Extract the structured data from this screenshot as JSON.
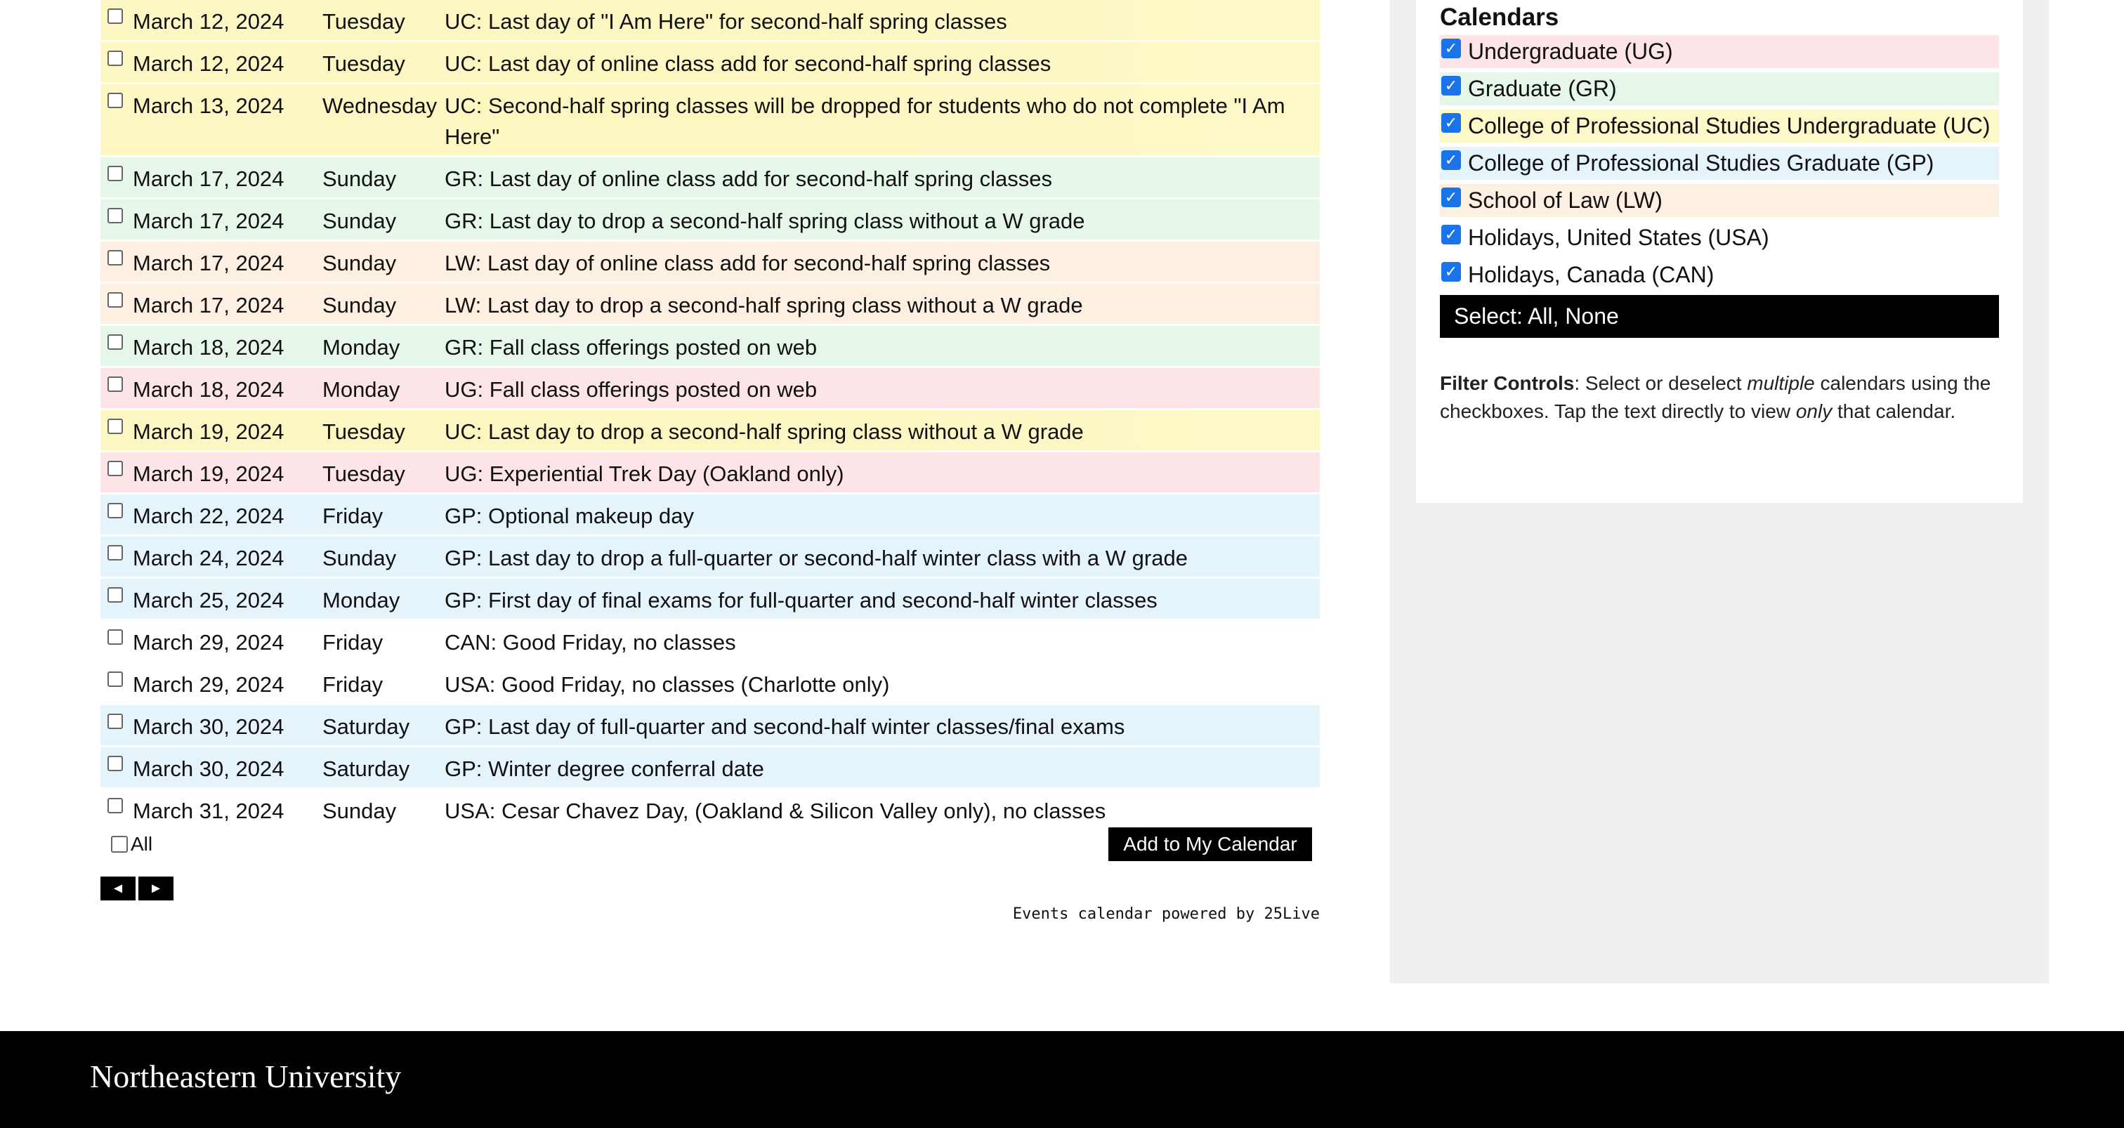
{
  "events": [
    {
      "date": "March 12, 2024",
      "day": "Tuesday",
      "event": "UC: Last day of \"I Am Here\" for second-half spring classes",
      "cal": "UC"
    },
    {
      "date": "March 12, 2024",
      "day": "Tuesday",
      "event": "UC: Last day of online class add for second-half spring classes",
      "cal": "UC"
    },
    {
      "date": "March 13, 2024",
      "day": "Wednesday",
      "event": "UC: Second-half spring classes will be dropped for students who do not complete \"I Am Here\"",
      "cal": "UC"
    },
    {
      "date": "March 17, 2024",
      "day": "Sunday",
      "event": "GR: Last day of online class add for second-half spring classes",
      "cal": "GR"
    },
    {
      "date": "March 17, 2024",
      "day": "Sunday",
      "event": "GR: Last day to drop a second-half spring class without a W grade",
      "cal": "GR"
    },
    {
      "date": "March 17, 2024",
      "day": "Sunday",
      "event": "LW: Last day of online class add for second-half spring classes",
      "cal": "LW"
    },
    {
      "date": "March 17, 2024",
      "day": "Sunday",
      "event": "LW: Last day to drop a second-half spring class without a W grade",
      "cal": "LW"
    },
    {
      "date": "March 18, 2024",
      "day": "Monday",
      "event": "GR: Fall class offerings posted on web",
      "cal": "GR"
    },
    {
      "date": "March 18, 2024",
      "day": "Monday",
      "event": "UG: Fall class offerings posted on web",
      "cal": "UG"
    },
    {
      "date": "March 19, 2024",
      "day": "Tuesday",
      "event": "UC: Last day to drop a second-half spring class without a W grade",
      "cal": "UC"
    },
    {
      "date": "March 19, 2024",
      "day": "Tuesday",
      "event": "UG: Experiential Trek Day (Oakland only)",
      "cal": "UG"
    },
    {
      "date": "March 22, 2024",
      "day": "Friday",
      "event": "GP: Optional makeup day",
      "cal": "GP"
    },
    {
      "date": "March 24, 2024",
      "day": "Sunday",
      "event": "GP: Last day to drop a full-quarter or second-half winter class with a W grade",
      "cal": "GP"
    },
    {
      "date": "March 25, 2024",
      "day": "Monday",
      "event": "GP: First day of final exams for full-quarter and second-half winter classes",
      "cal": "GP"
    },
    {
      "date": "March 29, 2024",
      "day": "Friday",
      "event": "CAN: Good Friday, no classes",
      "cal": "none"
    },
    {
      "date": "March 29, 2024",
      "day": "Friday",
      "event": "USA: Good Friday, no classes (Charlotte only)",
      "cal": "none"
    },
    {
      "date": "March 30, 2024",
      "day": "Saturday",
      "event": "GP: Last day of full-quarter and second-half winter classes/final exams",
      "cal": "GP"
    },
    {
      "date": "March 30, 2024",
      "day": "Saturday",
      "event": "GP: Winter degree conferral date",
      "cal": "GP"
    },
    {
      "date": "March 31, 2024",
      "day": "Sunday",
      "event": "USA: Cesar Chavez Day, (Oakland & Silicon Valley only), no classes",
      "cal": "none"
    }
  ],
  "controls": {
    "all_label": "All",
    "add_button": "Add to My Calendar",
    "prev_glyph": "◄",
    "next_glyph": "►",
    "powered_by": "Events calendar powered by 25Live"
  },
  "sidebar": {
    "title": "Calendars",
    "calendars": [
      {
        "label": "Undergraduate (UG)",
        "code": "UG",
        "checked": true
      },
      {
        "label": "Graduate (GR)",
        "code": "GR",
        "checked": true
      },
      {
        "label": "College of Professional Studies Undergraduate (UC)",
        "code": "UC",
        "checked": true
      },
      {
        "label": "College of Professional Studies Graduate (GP)",
        "code": "GP",
        "checked": true
      },
      {
        "label": "School of Law (LW)",
        "code": "LW",
        "checked": true
      },
      {
        "label": "Holidays, United States (USA)",
        "code": "USA",
        "checked": true
      },
      {
        "label": "Holidays, Canada (CAN)",
        "code": "CAN",
        "checked": true
      }
    ],
    "select_label": "Select: All, None",
    "filter_heading": "Filter Controls",
    "filter_text_1": ": Select or deselect ",
    "filter_em_1": "multiple",
    "filter_text_2": " calendars using the checkboxes. Tap the text directly to view ",
    "filter_em_2": "only",
    "filter_text_3": " that calendar."
  },
  "footer": {
    "brand": "Northeastern University"
  },
  "colors": {
    "UG": "#fde4e6",
    "GR": "#e6f7ea",
    "UC": "#fdf8c8",
    "GP": "#e5f3fb",
    "LW": "#fdefe1",
    "checkbox": "#1a73e8"
  }
}
